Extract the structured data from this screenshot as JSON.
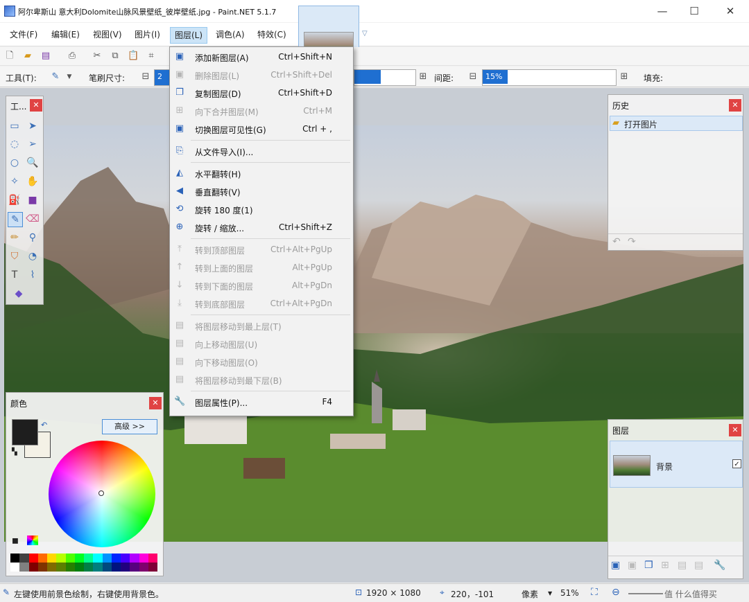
{
  "window": {
    "title": "阿尔卑斯山 意大利Dolomite山脉风景壁纸_彼岸壁纸.jpg - Paint.NET 5.1.7",
    "minimize_glyph": "—",
    "maximize_glyph": "☐",
    "close_glyph": "✕"
  },
  "menubar": {
    "items": [
      {
        "label": "文件(F)"
      },
      {
        "label": "编辑(E)"
      },
      {
        "label": "视图(V)"
      },
      {
        "label": "图片(I)"
      },
      {
        "label": "图层(L)"
      },
      {
        "label": "调色(A)"
      },
      {
        "label": "特效(C)"
      }
    ],
    "active_index": 4
  },
  "toolbar": {
    "tool_label": "工具(T):",
    "brush_size_label": "笔刷尺寸:",
    "brush_size_value": "2",
    "spacing_label": "间距:",
    "spacing_value": "15%",
    "fill_label": "填充:"
  },
  "layer_menu": {
    "items": [
      {
        "label": "添加新图层(A)",
        "shortcut": "Ctrl+Shift+N",
        "icon": "add-layer-icon",
        "enabled": true
      },
      {
        "label": "删除图层(L)",
        "shortcut": "Ctrl+Shift+Del",
        "icon": "delete-layer-icon",
        "enabled": false
      },
      {
        "label": "复制图层(D)",
        "shortcut": "Ctrl+Shift+D",
        "icon": "duplicate-layer-icon",
        "enabled": true
      },
      {
        "label": "向下合并图层(M)",
        "shortcut": "Ctrl+M",
        "icon": "merge-down-icon",
        "enabled": false
      },
      {
        "label": "切换图层可见性(G)",
        "shortcut": "Ctrl + ,",
        "icon": "visibility-icon",
        "enabled": true
      },
      {
        "label": "从文件导入(I)...",
        "shortcut": "",
        "icon": "import-icon",
        "enabled": true
      },
      {
        "label": "水平翻转(H)",
        "shortcut": "",
        "icon": "flip-horizontal-icon",
        "enabled": true
      },
      {
        "label": "垂直翻转(V)",
        "shortcut": "",
        "icon": "flip-vertical-icon",
        "enabled": true
      },
      {
        "label": "旋转 180 度(1)",
        "shortcut": "",
        "icon": "rotate-180-icon",
        "enabled": true
      },
      {
        "label": "旋转 / 缩放...",
        "shortcut": "Ctrl+Shift+Z",
        "icon": "rotate-zoom-icon",
        "enabled": true
      },
      {
        "label": "转到顶部图层",
        "shortcut": "Ctrl+Alt+PgUp",
        "icon": "go-top-icon",
        "enabled": false
      },
      {
        "label": "转到上面的图层",
        "shortcut": "Alt+PgUp",
        "icon": "go-up-icon",
        "enabled": false
      },
      {
        "label": "转到下面的图层",
        "shortcut": "Alt+PgDn",
        "icon": "go-down-icon",
        "enabled": false
      },
      {
        "label": "转到底部图层",
        "shortcut": "Ctrl+Alt+PgDn",
        "icon": "go-bottom-icon",
        "enabled": false
      },
      {
        "label": "将图层移动到最上层(T)",
        "shortcut": "",
        "icon": "move-top-icon",
        "enabled": false
      },
      {
        "label": "向上移动图层(U)",
        "shortcut": "",
        "icon": "move-up-icon",
        "enabled": false
      },
      {
        "label": "向下移动图层(O)",
        "shortcut": "",
        "icon": "move-down-icon",
        "enabled": false
      },
      {
        "label": "将图层移动到最下层(B)",
        "shortcut": "",
        "icon": "move-bottom-icon",
        "enabled": false
      },
      {
        "label": "图层属性(P)...",
        "shortcut": "F4",
        "icon": "properties-wrench-icon",
        "enabled": true
      }
    ]
  },
  "tools_panel": {
    "title": "工..."
  },
  "history_panel": {
    "title": "历史",
    "items": [
      "打开图片"
    ]
  },
  "layers_panel": {
    "title": "图层",
    "layer_name": "背景"
  },
  "colors_panel": {
    "title": "颜色",
    "advanced_button": "高级 >>"
  },
  "statusbar": {
    "hint": "左键使用前景色绘制，右键使用背景色。",
    "image_size": "1920 × 1080",
    "cursor_pos": "220，-101",
    "unit": "像素",
    "zoom": "51%"
  },
  "watermark": "值 什么值得买",
  "colors": {
    "accent": "#0078d7",
    "menu_highlight": "#cce4f7",
    "close_red": "#e04343"
  }
}
